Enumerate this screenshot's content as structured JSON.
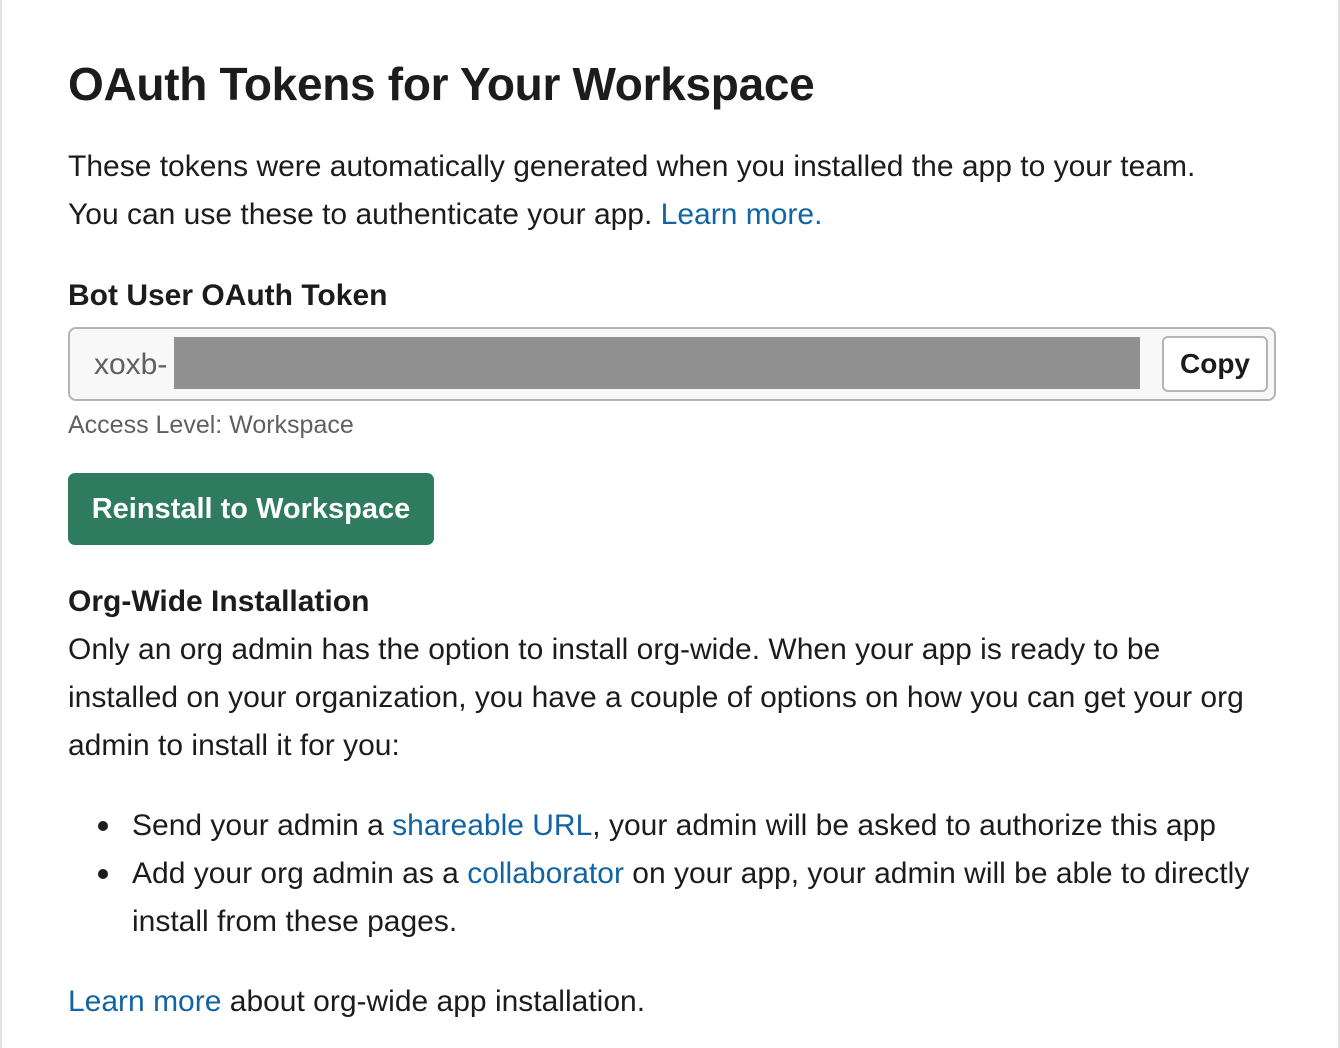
{
  "title": "OAuth Tokens for Your Workspace",
  "intro": {
    "line1": "These tokens were automatically generated when you installed the app to your team.",
    "line2": "You can use these to authenticate your app. ",
    "learn_more": "Learn more."
  },
  "bot_token": {
    "label": "Bot User OAuth Token",
    "value_prefix": "xoxb-",
    "copy_label": "Copy",
    "access_level": "Access Level: Workspace"
  },
  "reinstall_label": "Reinstall to Workspace",
  "org_wide": {
    "heading": "Org-Wide Installation",
    "description": "Only an org admin has the option to install org-wide. When your app is ready to be installed on your organization, you have a couple of options on how you can get your org admin to install it for you:",
    "options": [
      {
        "before": "Send your admin a ",
        "link": "shareable URL",
        "after": ", your admin will be asked to authorize this app"
      },
      {
        "before": "Add your org admin as a ",
        "link": "collaborator",
        "after": " on your app, your admin will be able to directly install from these pages."
      }
    ],
    "footer_link": "Learn more",
    "footer_text": " about org-wide app installation."
  },
  "colors": {
    "link": "#1264a3",
    "primary_button": "#2f7b5f",
    "redaction": "#919191"
  }
}
